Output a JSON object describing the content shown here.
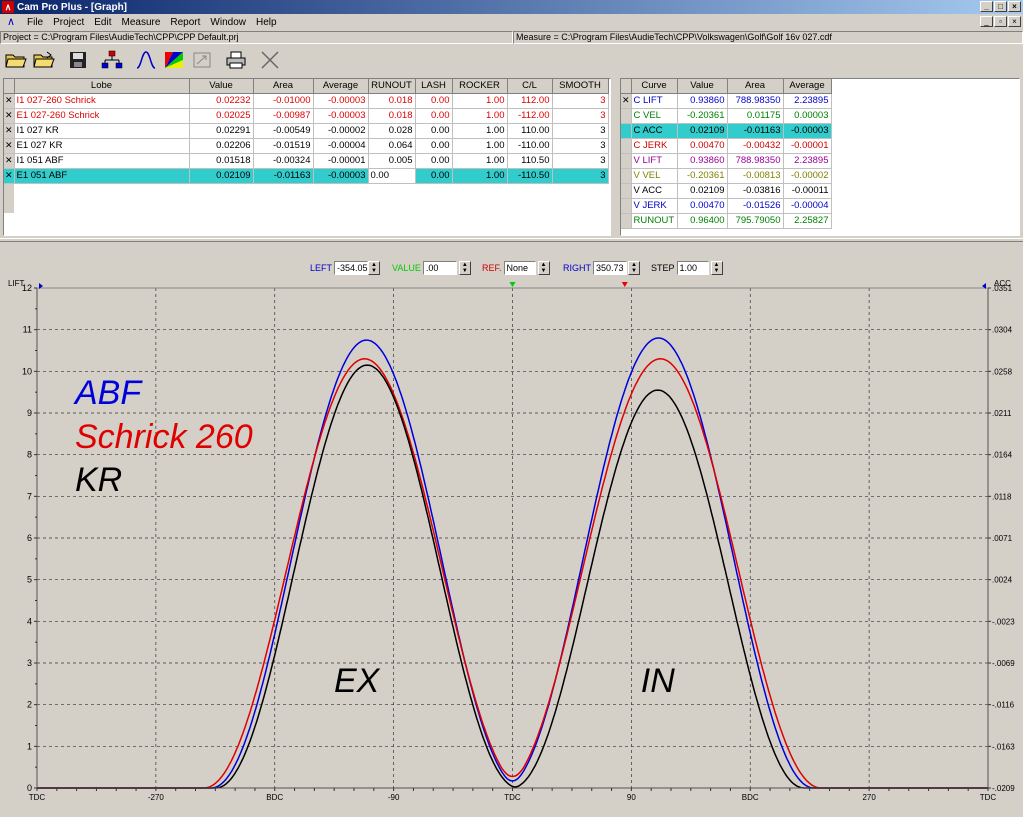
{
  "window": {
    "title": "Cam Pro Plus - [Graph]"
  },
  "menu": [
    "File",
    "Project",
    "Edit",
    "Measure",
    "Report",
    "Window",
    "Help"
  ],
  "paths": {
    "project": "Project = C:\\Program Files\\AudieTech\\CPP\\CPP Default.prj",
    "measure": "Measure = C:\\Program Files\\AudieTech\\CPP\\Volkswagen\\Golf\\Golf 16v 027.cdf"
  },
  "toolbar": [
    "open-icon",
    "open-folder-icon",
    "save-icon",
    "network-icon",
    "curve-icon",
    "color-icon",
    "resize-icon",
    "print-icon",
    "close-icon"
  ],
  "lobe_table": {
    "headers": [
      "Lobe",
      "Value",
      "Area",
      "Average",
      "RUNOUT",
      "LASH",
      "ROCKER",
      "C/L",
      "SMOOTH"
    ],
    "rows": [
      {
        "sel": "✕",
        "lobe": "I1 027-260 Schrick",
        "value": "0.02232",
        "area": "-0.01000",
        "average": "-0.00003",
        "runout": "0.018",
        "lash": "0.00",
        "rocker": "1.00",
        "cl": "112.00",
        "smooth": "3",
        "color": "#e00000"
      },
      {
        "sel": "✕",
        "lobe": "E1 027-260 Schrick",
        "value": "0.02025",
        "area": "-0.00987",
        "average": "-0.00003",
        "runout": "0.018",
        "lash": "0.00",
        "rocker": "1.00",
        "cl": "-112.00",
        "smooth": "3",
        "color": "#e00000"
      },
      {
        "sel": "✕",
        "lobe": "I1 027 KR",
        "value": "0.02291",
        "area": "-0.00549",
        "average": "-0.00002",
        "runout": "0.028",
        "lash": "0.00",
        "rocker": "1.00",
        "cl": "110.00",
        "smooth": "3",
        "color": "#000000"
      },
      {
        "sel": "✕",
        "lobe": "E1 027 KR",
        "value": "0.02206",
        "area": "-0.01519",
        "average": "-0.00004",
        "runout": "0.064",
        "lash": "0.00",
        "rocker": "1.00",
        "cl": "-110.00",
        "smooth": "3",
        "color": "#000000"
      },
      {
        "sel": "✕",
        "lobe": "I1 051 ABF",
        "value": "0.01518",
        "area": "-0.00324",
        "average": "-0.00001",
        "runout": "0.005",
        "lash": "0.00",
        "rocker": "1.00",
        "cl": "110.50",
        "smooth": "3",
        "color": "#000000"
      },
      {
        "sel": "✕",
        "lobe": "E1 051 ABF",
        "value": "0.02109",
        "area": "-0.01163",
        "average": "-0.00003",
        "runout": "0.00",
        "lash": "0.00",
        "rocker": "1.00",
        "cl": "-110.50",
        "smooth": "3",
        "color": "#000000",
        "highlight": true
      }
    ]
  },
  "curve_table": {
    "headers": [
      "Curve",
      "Value",
      "Area",
      "Average"
    ],
    "rows": [
      {
        "sel": "✕",
        "curve": "C LIFT",
        "value": "0.93860",
        "area": "788.98350",
        "average": "2.23895",
        "color": "#0000cc"
      },
      {
        "sel": "",
        "curve": "C VEL",
        "value": "-0.20361",
        "area": "0.01175",
        "average": "0.00003",
        "color": "#008000"
      },
      {
        "sel": "",
        "curve": "C ACC",
        "value": "0.02109",
        "area": "-0.01163",
        "average": "-0.00003",
        "color": "#000000",
        "highlight": true
      },
      {
        "sel": "",
        "curve": "C JERK",
        "value": "0.00470",
        "area": "-0.00432",
        "average": "-0.00001",
        "color": "#cc0000"
      },
      {
        "sel": "",
        "curve": "V LIFT",
        "value": "0.93860",
        "area": "788.98350",
        "average": "2.23895",
        "color": "#990099"
      },
      {
        "sel": "",
        "curve": "V VEL",
        "value": "-0.20361",
        "area": "-0.00813",
        "average": "-0.00002",
        "color": "#808000"
      },
      {
        "sel": "",
        "curve": "V ACC",
        "value": "0.02109",
        "area": "-0.03816",
        "average": "-0.00011",
        "color": "#000000"
      },
      {
        "sel": "",
        "curve": "V JERK",
        "value": "0.00470",
        "area": "-0.01526",
        "average": "-0.00004",
        "color": "#0000cc"
      },
      {
        "sel": "",
        "curve": "RUNOUT",
        "value": "0.96400",
        "area": "795.79050",
        "average": "2.25827",
        "color": "#008000"
      }
    ]
  },
  "controls": {
    "left_label": "LEFT",
    "left_value": "-354.05",
    "value_label": "VALUE",
    "value_value": ".00",
    "ref_label": "REF.",
    "ref_value": "None",
    "right_label": "RIGHT",
    "right_value": "350.73",
    "step_label": "STEP",
    "step_value": "1.00"
  },
  "chart_data": {
    "type": "line",
    "ylabel_left": "LIFT",
    "ylabel_right": "ACC",
    "ylim": [
      0,
      12
    ],
    "xlim": [
      -360,
      360
    ],
    "yticks": [
      "0",
      "1",
      "2",
      "3",
      "4",
      "5",
      "6",
      "7",
      "8",
      "9",
      "10",
      "11",
      "12"
    ],
    "yticks_right": [
      "-.0209",
      "-.0163",
      "-.0116",
      "-.0069",
      "-.0023",
      ".0024",
      ".0071",
      ".0118",
      ".0164",
      ".0211",
      ".0258",
      ".0304",
      ".0351"
    ],
    "xticks": [
      {
        "x": -360,
        "label": "TDC"
      },
      {
        "x": -270,
        "label": "-270"
      },
      {
        "x": -180,
        "label": "BDC"
      },
      {
        "x": -90,
        "label": "-90"
      },
      {
        "x": 0,
        "label": "TDC"
      },
      {
        "x": 90,
        "label": "90"
      },
      {
        "x": 180,
        "label": "BDC"
      },
      {
        "x": 270,
        "label": "270"
      },
      {
        "x": 360,
        "label": "TDC"
      }
    ],
    "grid": true,
    "legend": [
      {
        "name": "ABF",
        "color": "#0000dd"
      },
      {
        "name": "Schrick 260",
        "color": "#e00000"
      },
      {
        "name": "KR",
        "color": "#000000"
      }
    ],
    "annotations": [
      {
        "text": "EX",
        "x": -118,
        "y": 2.3
      },
      {
        "text": "IN",
        "x": 110,
        "y": 2.3
      }
    ],
    "series": [
      {
        "name": "ABF",
        "color": "#0000dd",
        "lobes": [
          {
            "center": -110.5,
            "peak": 10.75,
            "half_duration": 118
          },
          {
            "center": 110.5,
            "peak": 10.8,
            "half_duration": 118
          }
        ]
      },
      {
        "name": "Schrick 260",
        "color": "#e00000",
        "lobes": [
          {
            "center": -112,
            "peak": 10.3,
            "half_duration": 122
          },
          {
            "center": 112,
            "peak": 10.3,
            "half_duration": 122
          }
        ]
      },
      {
        "name": "KR",
        "color": "#000000",
        "lobes": [
          {
            "center": -110,
            "peak": 10.15,
            "half_duration": 115
          },
          {
            "center": 110,
            "peak": 9.55,
            "half_duration": 111
          }
        ]
      }
    ]
  }
}
